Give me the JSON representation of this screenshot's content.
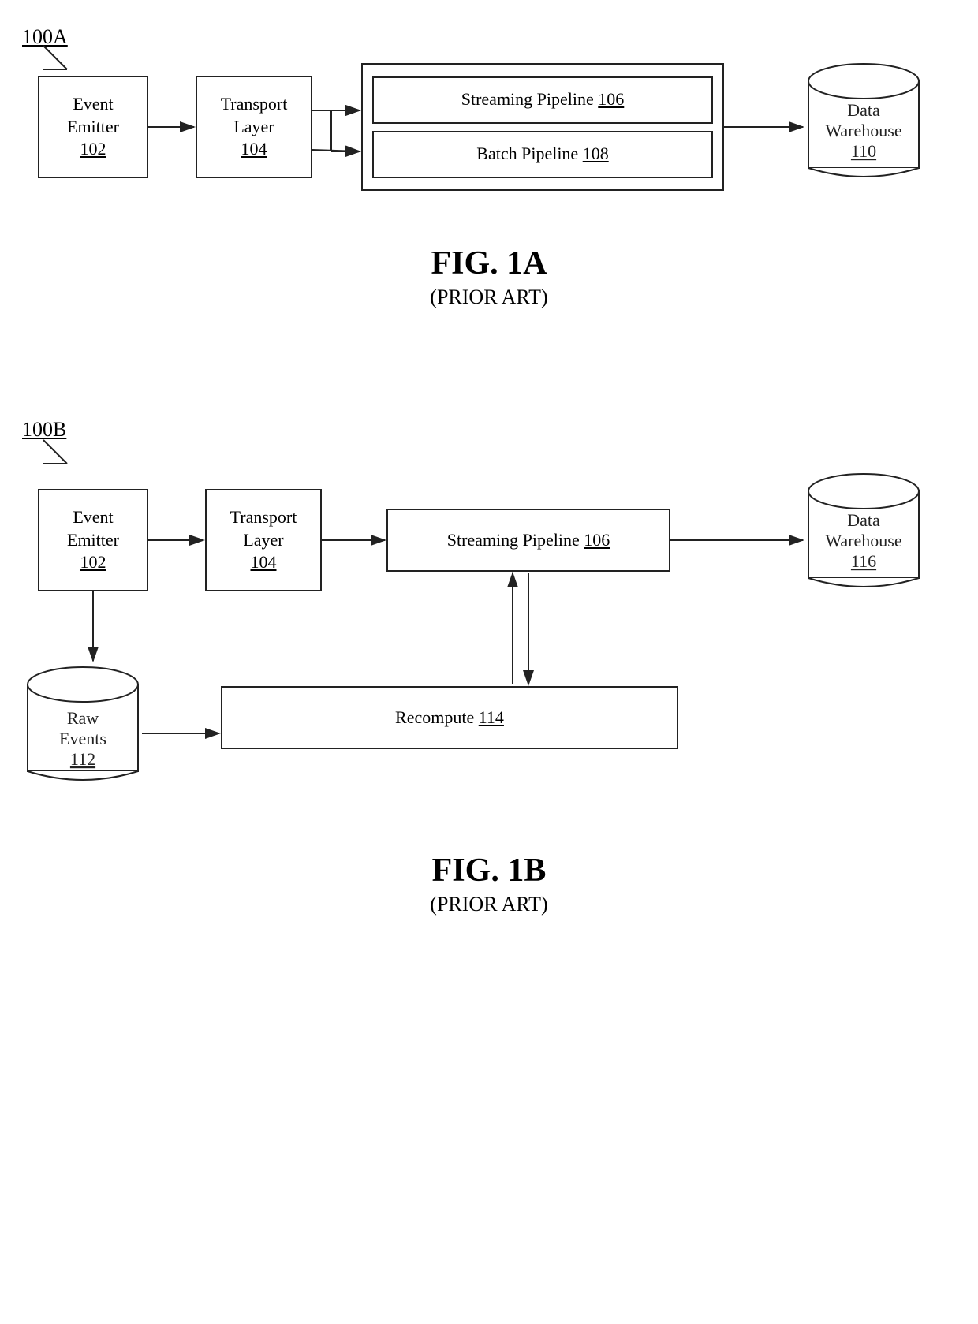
{
  "fig1a": {
    "label": "100A",
    "event_emitter": {
      "line1": "Event",
      "line2": "Emitter",
      "ref": "102"
    },
    "transport_layer": {
      "line1": "Transport",
      "line2": "Layer",
      "ref": "104"
    },
    "streaming_pipeline": {
      "line1": "Streaming Pipeline",
      "ref": "106"
    },
    "batch_pipeline": {
      "line1": "Batch Pipeline",
      "ref": "108"
    },
    "data_warehouse": {
      "line1": "Data",
      "line2": "Warehouse",
      "ref": "110"
    },
    "fig_name": "FIG. 1A",
    "fig_sub": "(PRIOR ART)"
  },
  "fig1b": {
    "label": "100B",
    "event_emitter": {
      "line1": "Event",
      "line2": "Emitter",
      "ref": "102"
    },
    "transport_layer": {
      "line1": "Transport",
      "line2": "Layer",
      "ref": "104"
    },
    "streaming_pipeline": {
      "line1": "Streaming Pipeline",
      "ref": "106"
    },
    "data_warehouse": {
      "line1": "Data",
      "line2": "Warehouse",
      "ref": "116"
    },
    "raw_events": {
      "line1": "Raw",
      "line2": "Events",
      "ref": "112"
    },
    "recompute": {
      "line1": "Recompute",
      "ref": "114"
    },
    "fig_name": "FIG. 1B",
    "fig_sub": "(PRIOR ART)"
  }
}
